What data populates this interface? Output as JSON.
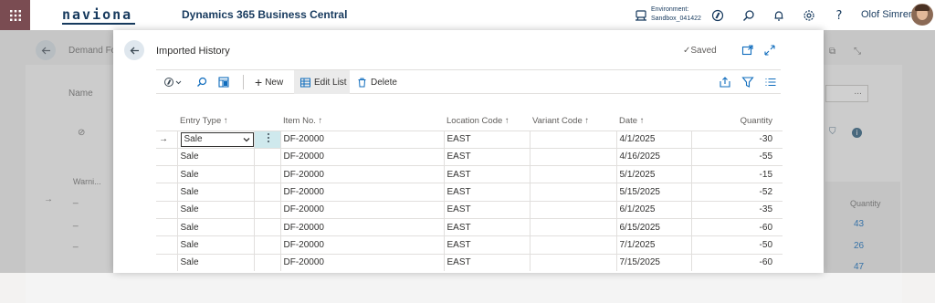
{
  "topbar": {
    "logo": "naviona",
    "product": "Dynamics 365 Business Central",
    "environment_label": "Environment:",
    "environment_name": "Sandbox_041422",
    "user": "Olof Simren"
  },
  "background_page": {
    "title": "Demand Fo",
    "name_label": "Name",
    "column_warning": "Warni...",
    "column_quantity": "Quantity",
    "rows": [
      {
        "warning": "_",
        "quantity": "43"
      },
      {
        "warning": "_",
        "quantity": "26"
      },
      {
        "warning": "_",
        "quantity": "47"
      }
    ],
    "ellipsis": "..."
  },
  "dialog": {
    "title": "Imported History",
    "saved": "Saved",
    "actions": {
      "new": "New",
      "edit_list": "Edit List",
      "delete": "Delete"
    },
    "columns": {
      "entry_type": "Entry Type",
      "item_no": "Item No.",
      "location": "Location Code",
      "variant": "Variant Code",
      "date": "Date",
      "quantity": "Quantity"
    },
    "rows": [
      {
        "entry_type": "Sale",
        "item_no": "DF-20000",
        "location": "EAST",
        "variant": "",
        "date": "4/1/2025",
        "quantity": "-30"
      },
      {
        "entry_type": "Sale",
        "item_no": "DF-20000",
        "location": "EAST",
        "variant": "",
        "date": "4/16/2025",
        "quantity": "-55"
      },
      {
        "entry_type": "Sale",
        "item_no": "DF-20000",
        "location": "EAST",
        "variant": "",
        "date": "5/1/2025",
        "quantity": "-15"
      },
      {
        "entry_type": "Sale",
        "item_no": "DF-20000",
        "location": "EAST",
        "variant": "",
        "date": "5/15/2025",
        "quantity": "-52"
      },
      {
        "entry_type": "Sale",
        "item_no": "DF-20000",
        "location": "EAST",
        "variant": "",
        "date": "6/1/2025",
        "quantity": "-35"
      },
      {
        "entry_type": "Sale",
        "item_no": "DF-20000",
        "location": "EAST",
        "variant": "",
        "date": "6/15/2025",
        "quantity": "-60"
      },
      {
        "entry_type": "Sale",
        "item_no": "DF-20000",
        "location": "EAST",
        "variant": "",
        "date": "7/1/2025",
        "quantity": "-50"
      },
      {
        "entry_type": "Sale",
        "item_no": "DF-20000",
        "location": "EAST",
        "variant": "",
        "date": "7/15/2025",
        "quantity": "-60"
      }
    ]
  },
  "colors": {
    "waffle": "#7a4c52",
    "brand_text": "#173a5e",
    "accent": "#0f6cbd",
    "selected_cell": "#cfe9ed"
  }
}
